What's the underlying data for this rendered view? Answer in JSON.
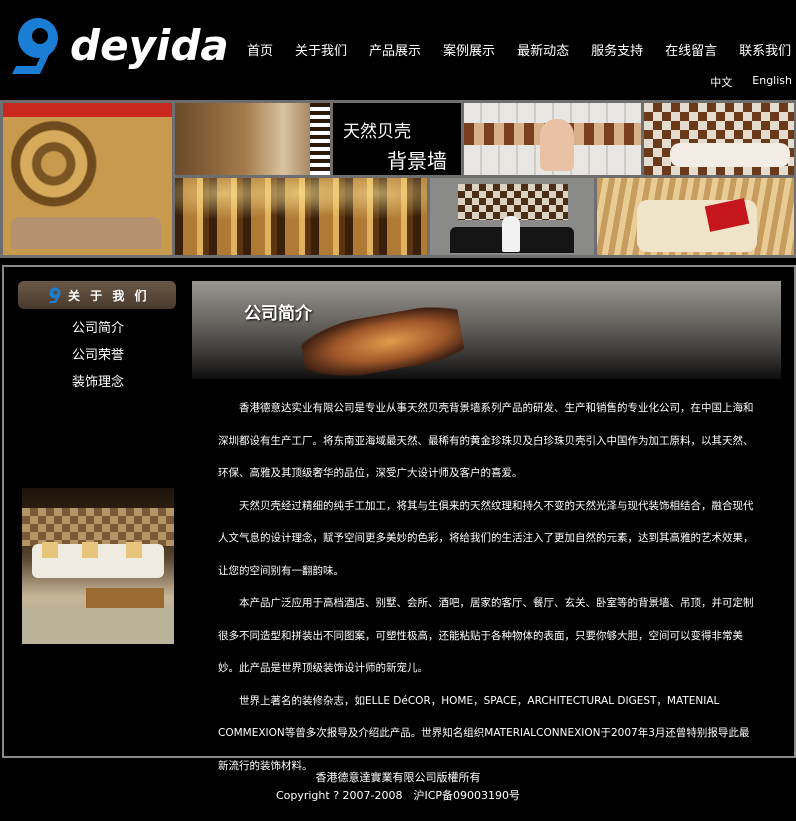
{
  "header": {
    "logo_text": "deyida",
    "nav": [
      "首页",
      "关于我们",
      "产品展示",
      "案例展示",
      "最新动态",
      "服务支持",
      "在线留言",
      "联系我们"
    ],
    "languages": [
      "中文",
      "English"
    ]
  },
  "banner": {
    "slogan_line1": "天然贝壳",
    "slogan_line2": "背景墙"
  },
  "sidebar": {
    "title": "关 于 我 们",
    "items": [
      "公司简介",
      "公司荣誉",
      "装饰理念"
    ]
  },
  "main": {
    "section_title": "公司简介",
    "paragraphs": [
      "香港德意达实业有限公司是专业从事天然贝壳背景墙系列产品的研发、生产和销售的专业化公司，在中国上海和深圳都设有生产工厂。将东南亚海域最天然、最稀有的黄金珍珠贝及白珍珠贝壳引入中国作为加工原料，以其天然、环保、高雅及其顶级奢华的品位，深受广大设计师及客户的喜爱。",
      "天然贝壳经过精细的纯手工加工，将其与生俱来的天然纹理和持久不变的天然光泽与现代装饰相结合，融合现代人文气息的设计理念，赋予空间更多美妙的色彩，将给我们的生活注入了更加自然的元素，达到其高雅的艺术效果，让您的空间别有一翻韵味。",
      "本产品广泛应用于高档酒店、别墅、会所、酒吧，居家的客厅、餐厅、玄关、卧室等的背景墙、吊顶，并可定制很多不同造型和拼装出不同图案，可塑性极高，还能粘贴于各种物体的表面，只要你够大胆，空间可以变得非常美妙。此产品是世界顶级装饰设计师的新宠儿。",
      "世界上著名的装修杂志，如ELLE DéCOR，HOME，SPACE，ARCHITECTURAL DIGEST，MATENIAL COMMEXION等曾多次报导及介绍此产品。世界知名组织MATERIALCONNEXION于2007年3月还曾特别报导此最新流行的装饰材料。"
    ]
  },
  "footer": {
    "line1": "香港德意達實業有限公司版權所有",
    "line2": "Copyright ? 2007-2008　沪ICP备09003190号"
  },
  "colors": {
    "background": "#000000",
    "logo_blue": "#1a7fd4",
    "sidebar_header": "#5a4838",
    "frame_border": "#8a8a8a"
  }
}
